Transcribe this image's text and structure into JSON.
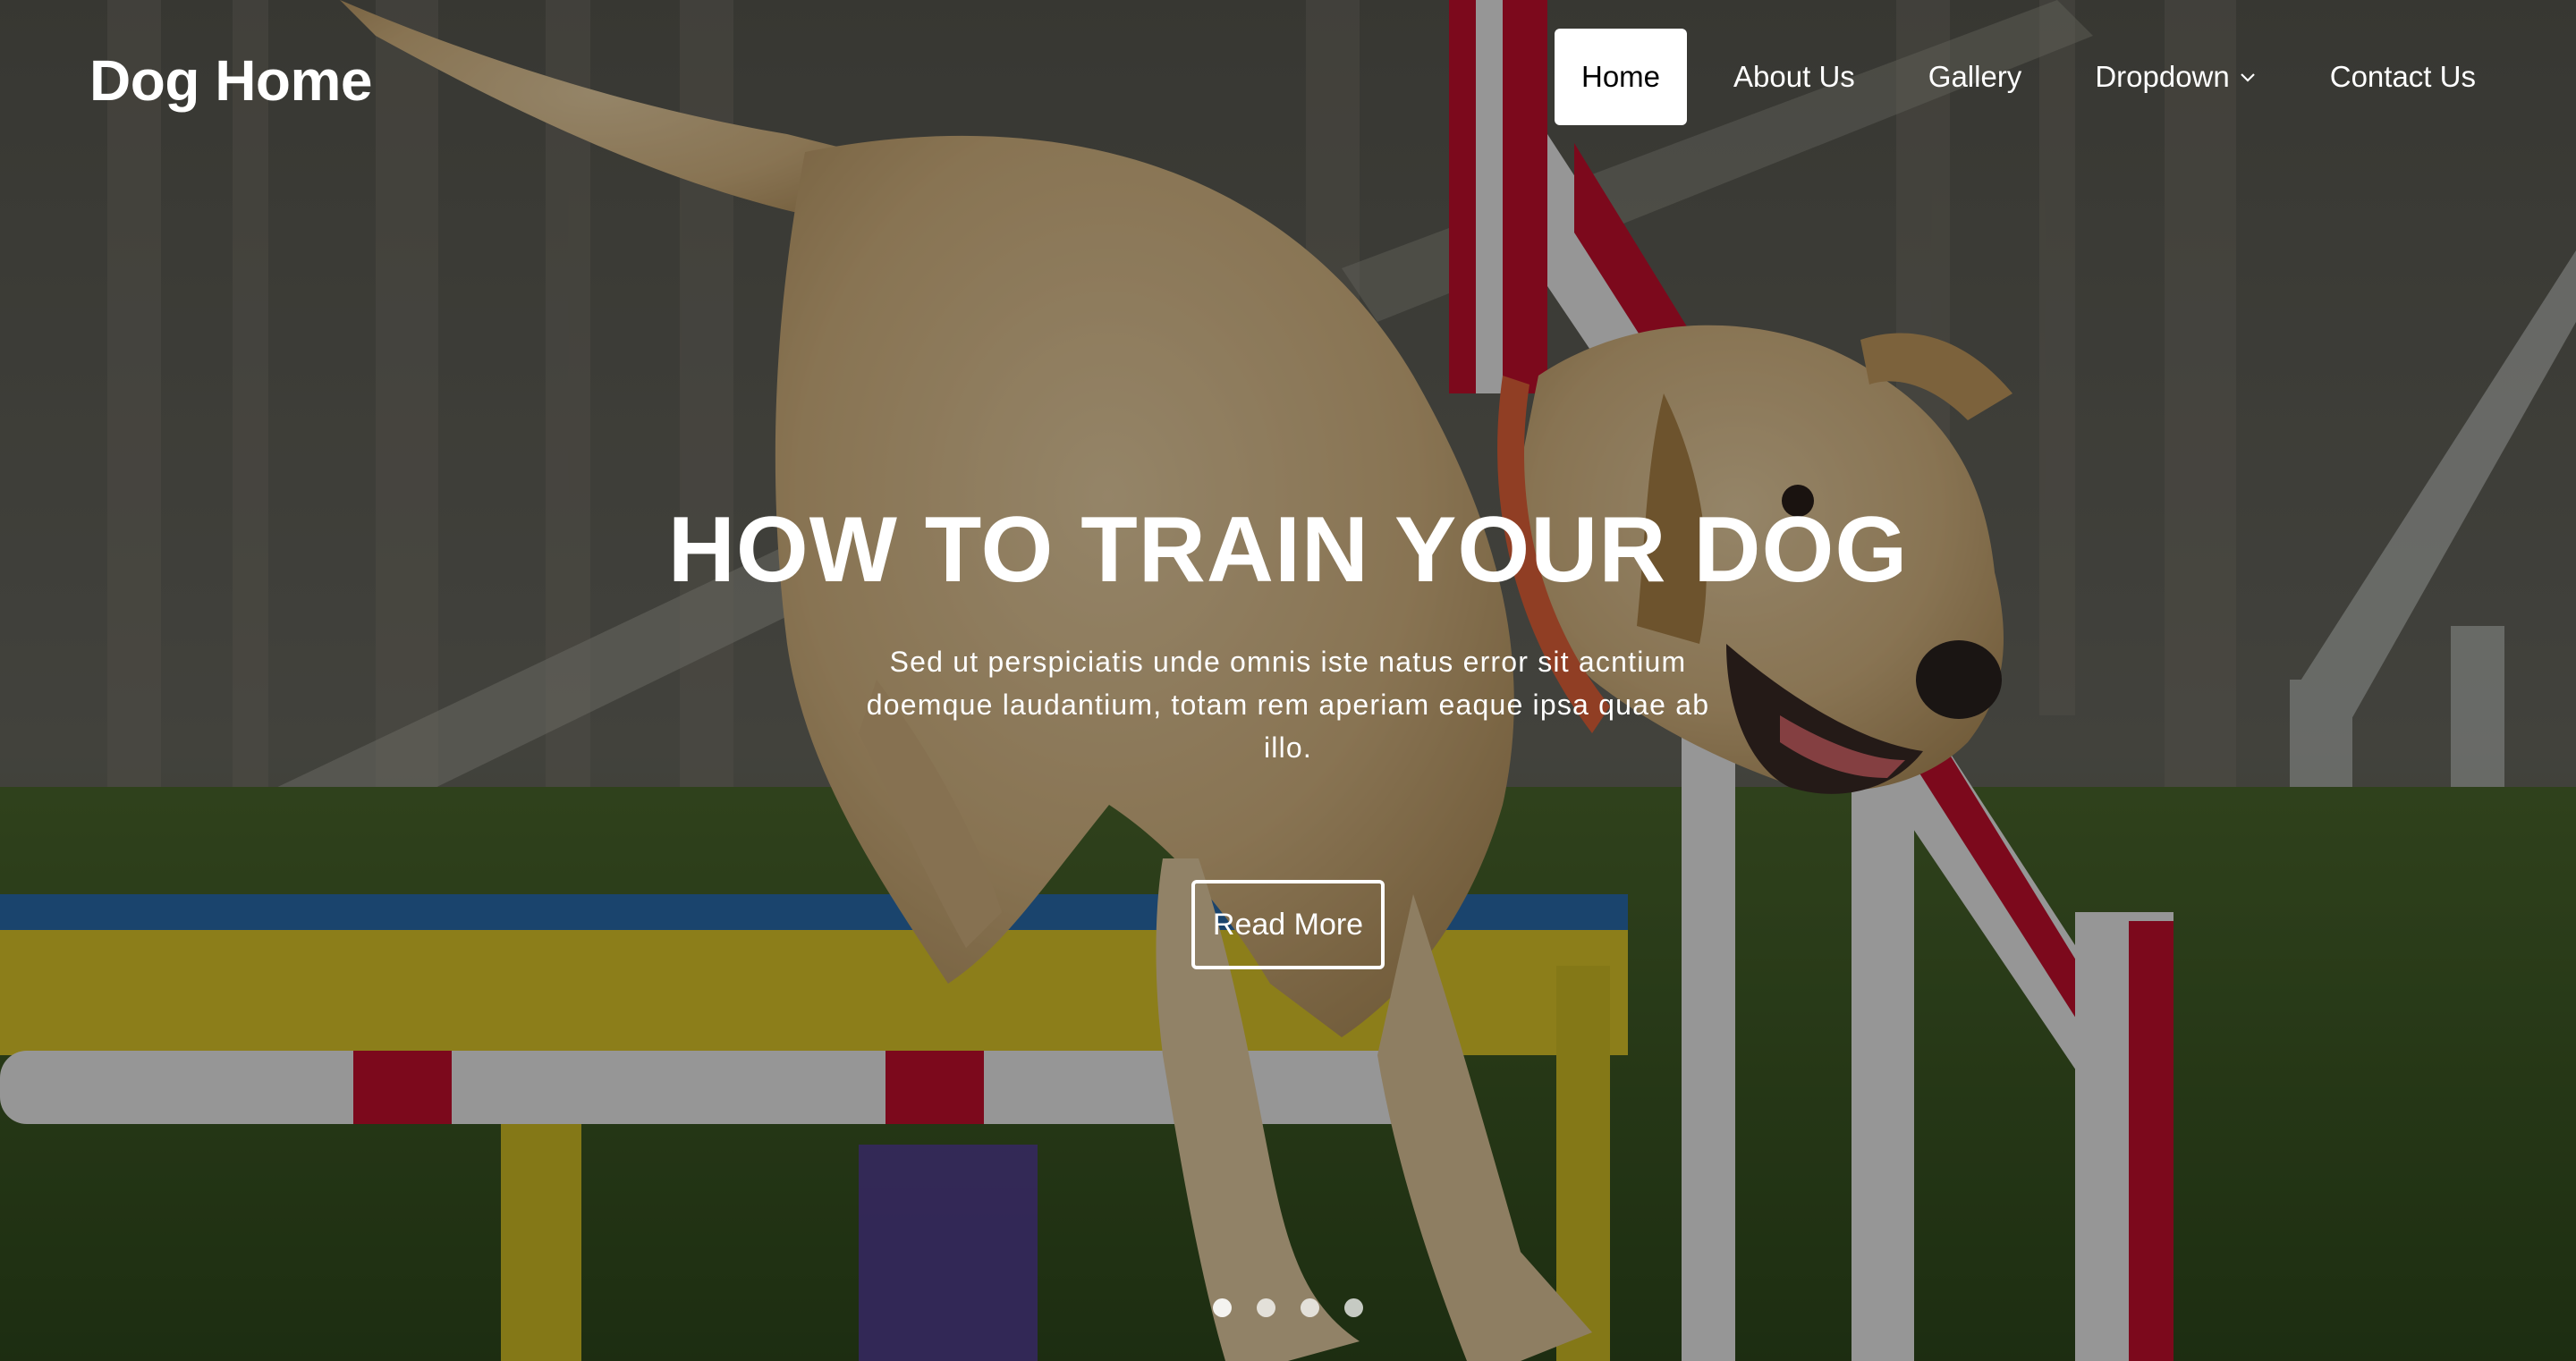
{
  "header": {
    "logo": "Dog Home",
    "nav": [
      {
        "label": "Home",
        "active": true
      },
      {
        "label": "About Us",
        "active": false
      },
      {
        "label": "Gallery",
        "active": false
      },
      {
        "label": "Dropdown",
        "active": false,
        "has_dropdown": true
      },
      {
        "label": "Contact Us",
        "active": false
      }
    ]
  },
  "hero": {
    "title": "HOW TO TRAIN YOUR DOG",
    "text": "Sed ut perspiciatis unde omnis iste natus error sit acntium doemque laudantium, totam rem aperiam eaque ipsa quae ab illo.",
    "button_label": "Read More",
    "background_image": "dog-jumping-agility-hurdle",
    "overlay_color": "#000000"
  },
  "carousel": {
    "slide_count": 4,
    "active_index": 0
  },
  "colors": {
    "nav_active_bg": "#ffffff",
    "nav_active_text": "#000000",
    "text": "#ffffff"
  }
}
